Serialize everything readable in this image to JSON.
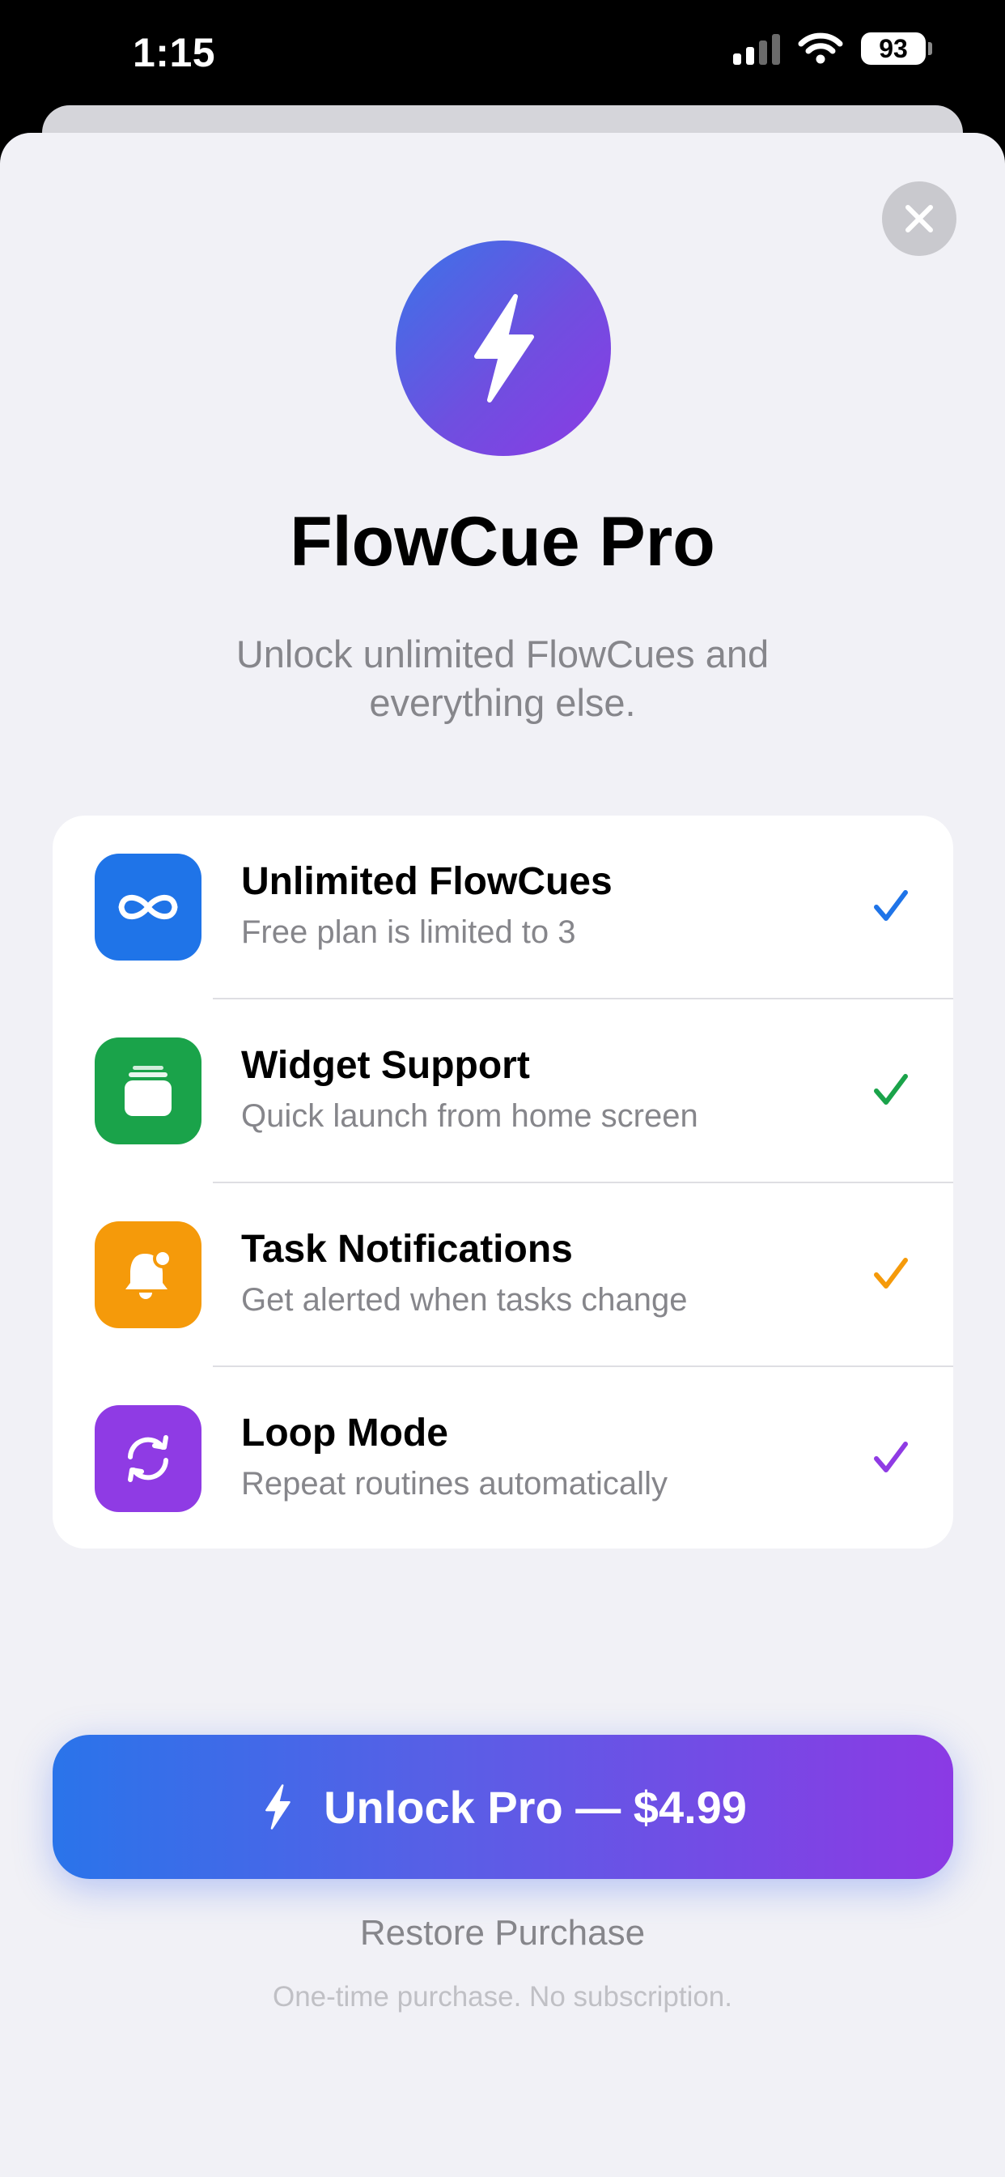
{
  "status_bar": {
    "time": "1:15",
    "battery": "93",
    "signal_bars": 2
  },
  "header": {
    "close_icon": "close-icon"
  },
  "hero": {
    "icon": "bolt-icon",
    "title": "FlowCue Pro",
    "subtitle": "Unlock unlimited FlowCues and everything else."
  },
  "features": [
    {
      "title": "Unlimited FlowCues",
      "desc": "Free plan is limited to 3",
      "icon": "infinity-icon",
      "color": "#1f74e8"
    },
    {
      "title": "Widget Support",
      "desc": "Quick launch from home screen",
      "icon": "widget-stack-icon",
      "color": "#1aa34a"
    },
    {
      "title": "Task Notifications",
      "desc": "Get alerted when tasks change",
      "icon": "bell-badge-icon",
      "color": "#f59a0a"
    },
    {
      "title": "Loop Mode",
      "desc": "Repeat routines automatically",
      "icon": "loop-arrows-icon",
      "color": "#8f3be4"
    }
  ],
  "cta": {
    "label": "Unlock Pro — $4.99",
    "icon": "bolt-icon"
  },
  "restore_label": "Restore Purchase",
  "footnote": "One-time purchase. No subscription.",
  "colors": {
    "sheet_bg": "#f1f1f6",
    "gradient_start": "#2a74ea",
    "gradient_end": "#8b3ae4"
  }
}
